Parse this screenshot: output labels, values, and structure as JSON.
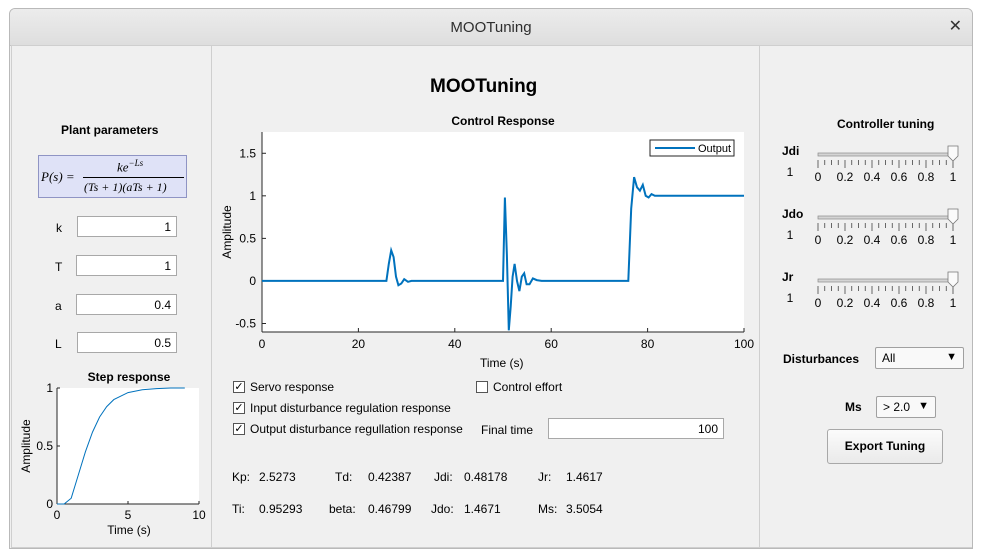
{
  "window": {
    "title": "MOOTuning"
  },
  "left": {
    "heading": "Plant parameters",
    "formula": {
      "lhs": "P(s) =",
      "numerator": "ke",
      "exponent": "−Ls",
      "denominator": "(Ts + 1)(aTs + 1)"
    },
    "params": [
      {
        "label": "k",
        "value": "1"
      },
      {
        "label": "T",
        "value": "1"
      },
      {
        "label": "a",
        "value": "0.4"
      },
      {
        "label": "L",
        "value": "0.5"
      }
    ],
    "step_title": "Step response",
    "step_ylabel": "Amplitude",
    "step_xlabel": "Time (s)",
    "step_yticks": [
      "0",
      "0.5",
      "1"
    ],
    "step_xticks": [
      "0",
      "5",
      "10"
    ]
  },
  "center": {
    "heading": "MOOTuning",
    "chart_title": "Control Response",
    "ylabel": "Amplitude",
    "xlabel": "Time (s)",
    "xticks": [
      "0",
      "20",
      "40",
      "60",
      "80",
      "100"
    ],
    "yticks": [
      "-0.5",
      "0",
      "0.5",
      "1",
      "1.5"
    ],
    "legend": "Output",
    "checkboxes": [
      {
        "label": "Servo response",
        "checked": true
      },
      {
        "label": "Input disturbance regulation response",
        "checked": true
      },
      {
        "label": "Output disturbance regullation response",
        "checked": true
      },
      {
        "label": "Control effort",
        "checked": false
      }
    ],
    "final_time_label": "Final time",
    "final_time_value": "100",
    "results_row1": [
      {
        "label": "Kp:",
        "value": "2.5273"
      },
      {
        "label": "Td:",
        "value": "0.42387"
      },
      {
        "label": "Jdi:",
        "value": "0.48178"
      },
      {
        "label": "Jr:",
        "value": "1.4617"
      }
    ],
    "results_row2": [
      {
        "label": "Ti:",
        "value": "0.95293"
      },
      {
        "label": "beta:",
        "value": "0.46799"
      },
      {
        "label": "Jdo:",
        "value": "1.4671"
      },
      {
        "label": "Ms:",
        "value": "3.5054"
      }
    ]
  },
  "right": {
    "heading": "Controller tuning",
    "sliders": [
      {
        "label": "Jdi",
        "value_text": "1",
        "value": 1
      },
      {
        "label": "Jdo",
        "value_text": "1",
        "value": 1
      },
      {
        "label": "Jr",
        "value_text": "1",
        "value": 1
      }
    ],
    "slider_ticks": [
      "0",
      "0.2",
      "0.4",
      "0.6",
      "0.8",
      "1"
    ],
    "disturbances_label": "Disturbances",
    "disturbances_value": "All",
    "ms_label": "Ms",
    "ms_value": "> 2.0",
    "export_label": "Export Tuning"
  },
  "colors": {
    "line": "#0072bd"
  },
  "chart_data": [
    {
      "type": "line",
      "title": "Control Response",
      "xlabel": "Time (s)",
      "ylabel": "Amplitude",
      "xlim": [
        0,
        100
      ],
      "ylim": [
        -0.6,
        1.75
      ],
      "legend": "top-right",
      "series": [
        {
          "name": "Output",
          "points": [
            [
              0,
              0
            ],
            [
              25,
              0
            ],
            [
              25.8,
              0
            ],
            [
              26.3,
              0.2
            ],
            [
              26.8,
              0.36
            ],
            [
              27.3,
              0.28
            ],
            [
              27.8,
              0.05
            ],
            [
              28.3,
              -0.05
            ],
            [
              28.9,
              -0.03
            ],
            [
              29.5,
              0.02
            ],
            [
              30.3,
              -0.01
            ],
            [
              31,
              0
            ],
            [
              40,
              0
            ],
            [
              50,
              0
            ],
            [
              50.4,
              0.98
            ],
            [
              50.8,
              0.3
            ],
            [
              51.2,
              -0.58
            ],
            [
              51.6,
              -0.3
            ],
            [
              52,
              0.05
            ],
            [
              52.4,
              0.2
            ],
            [
              52.9,
              0
            ],
            [
              53.4,
              -0.12
            ],
            [
              53.9,
              0.05
            ],
            [
              54.4,
              0.09
            ],
            [
              54.9,
              -0.04
            ],
            [
              55.5,
              -0.04
            ],
            [
              56.2,
              0.03
            ],
            [
              57,
              0.01
            ],
            [
              58,
              0
            ],
            [
              75,
              0
            ],
            [
              76,
              0
            ],
            [
              76.6,
              0.85
            ],
            [
              77.2,
              1.22
            ],
            [
              77.8,
              1.1
            ],
            [
              78.4,
              1.06
            ],
            [
              79,
              1.13
            ],
            [
              79.6,
              1.0
            ],
            [
              80.2,
              0.98
            ],
            [
              80.8,
              1.02
            ],
            [
              81.5,
              1.0
            ],
            [
              100,
              1.0
            ]
          ]
        }
      ]
    },
    {
      "type": "line",
      "title": "Step response",
      "xlabel": "Time (s)",
      "ylabel": "Amplitude",
      "xlim": [
        0,
        10
      ],
      "ylim": [
        0,
        1
      ],
      "series": [
        {
          "name": "",
          "points": [
            [
              0,
              0
            ],
            [
              0.5,
              0
            ],
            [
              1,
              0.05
            ],
            [
              1.5,
              0.25
            ],
            [
              2,
              0.45
            ],
            [
              2.5,
              0.62
            ],
            [
              3,
              0.75
            ],
            [
              3.5,
              0.84
            ],
            [
              4,
              0.9
            ],
            [
              5,
              0.96
            ],
            [
              6,
              0.985
            ],
            [
              7,
              0.995
            ],
            [
              8,
              1
            ],
            [
              9,
              1
            ]
          ]
        }
      ]
    }
  ]
}
